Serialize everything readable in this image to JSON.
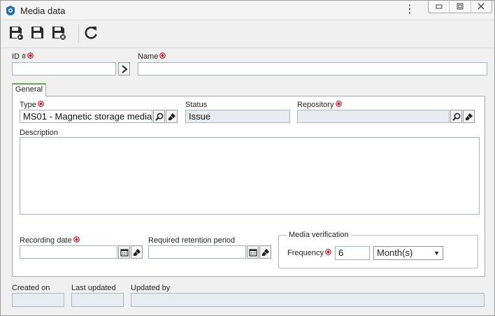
{
  "window": {
    "title": "Media data"
  },
  "fields": {
    "id_label": "ID #",
    "name_label": "Name",
    "id_value": "",
    "name_value": ""
  },
  "tabs": [
    {
      "label": "General",
      "active": true
    }
  ],
  "general": {
    "type_label": "Type",
    "type_value": "MS01 - Magnetic storage media",
    "status_label": "Status",
    "status_value": "Issue",
    "repository_label": "Repository",
    "repository_value": "",
    "description_label": "Description",
    "description_value": "",
    "recording_date_label": "Recording date",
    "recording_date_value": "",
    "retention_label": "Required retention period",
    "retention_value": "",
    "media_verification_legend": "Media verification",
    "frequency_label": "Frequency",
    "frequency_value": "6",
    "frequency_unit": "Month(s)"
  },
  "footer": {
    "created_on_label": "Created on",
    "last_updated_label": "Last updated",
    "updated_by_label": "Updated by",
    "created_on_value": "",
    "last_updated_value": "",
    "updated_by_value": ""
  },
  "icons": {
    "toolbar": [
      "save-and-new-icon",
      "save-icon",
      "save-and-close-icon",
      "refresh-icon"
    ],
    "field_buttons": [
      "arrow-right-icon",
      "search-icon",
      "eraser-icon",
      "calendar-icon"
    ]
  },
  "colors": {
    "required": "#d0021b",
    "tab_accent": "#6aa84f",
    "input_border": "#9fb3c8",
    "readonly_bg": "#e8ebef"
  }
}
